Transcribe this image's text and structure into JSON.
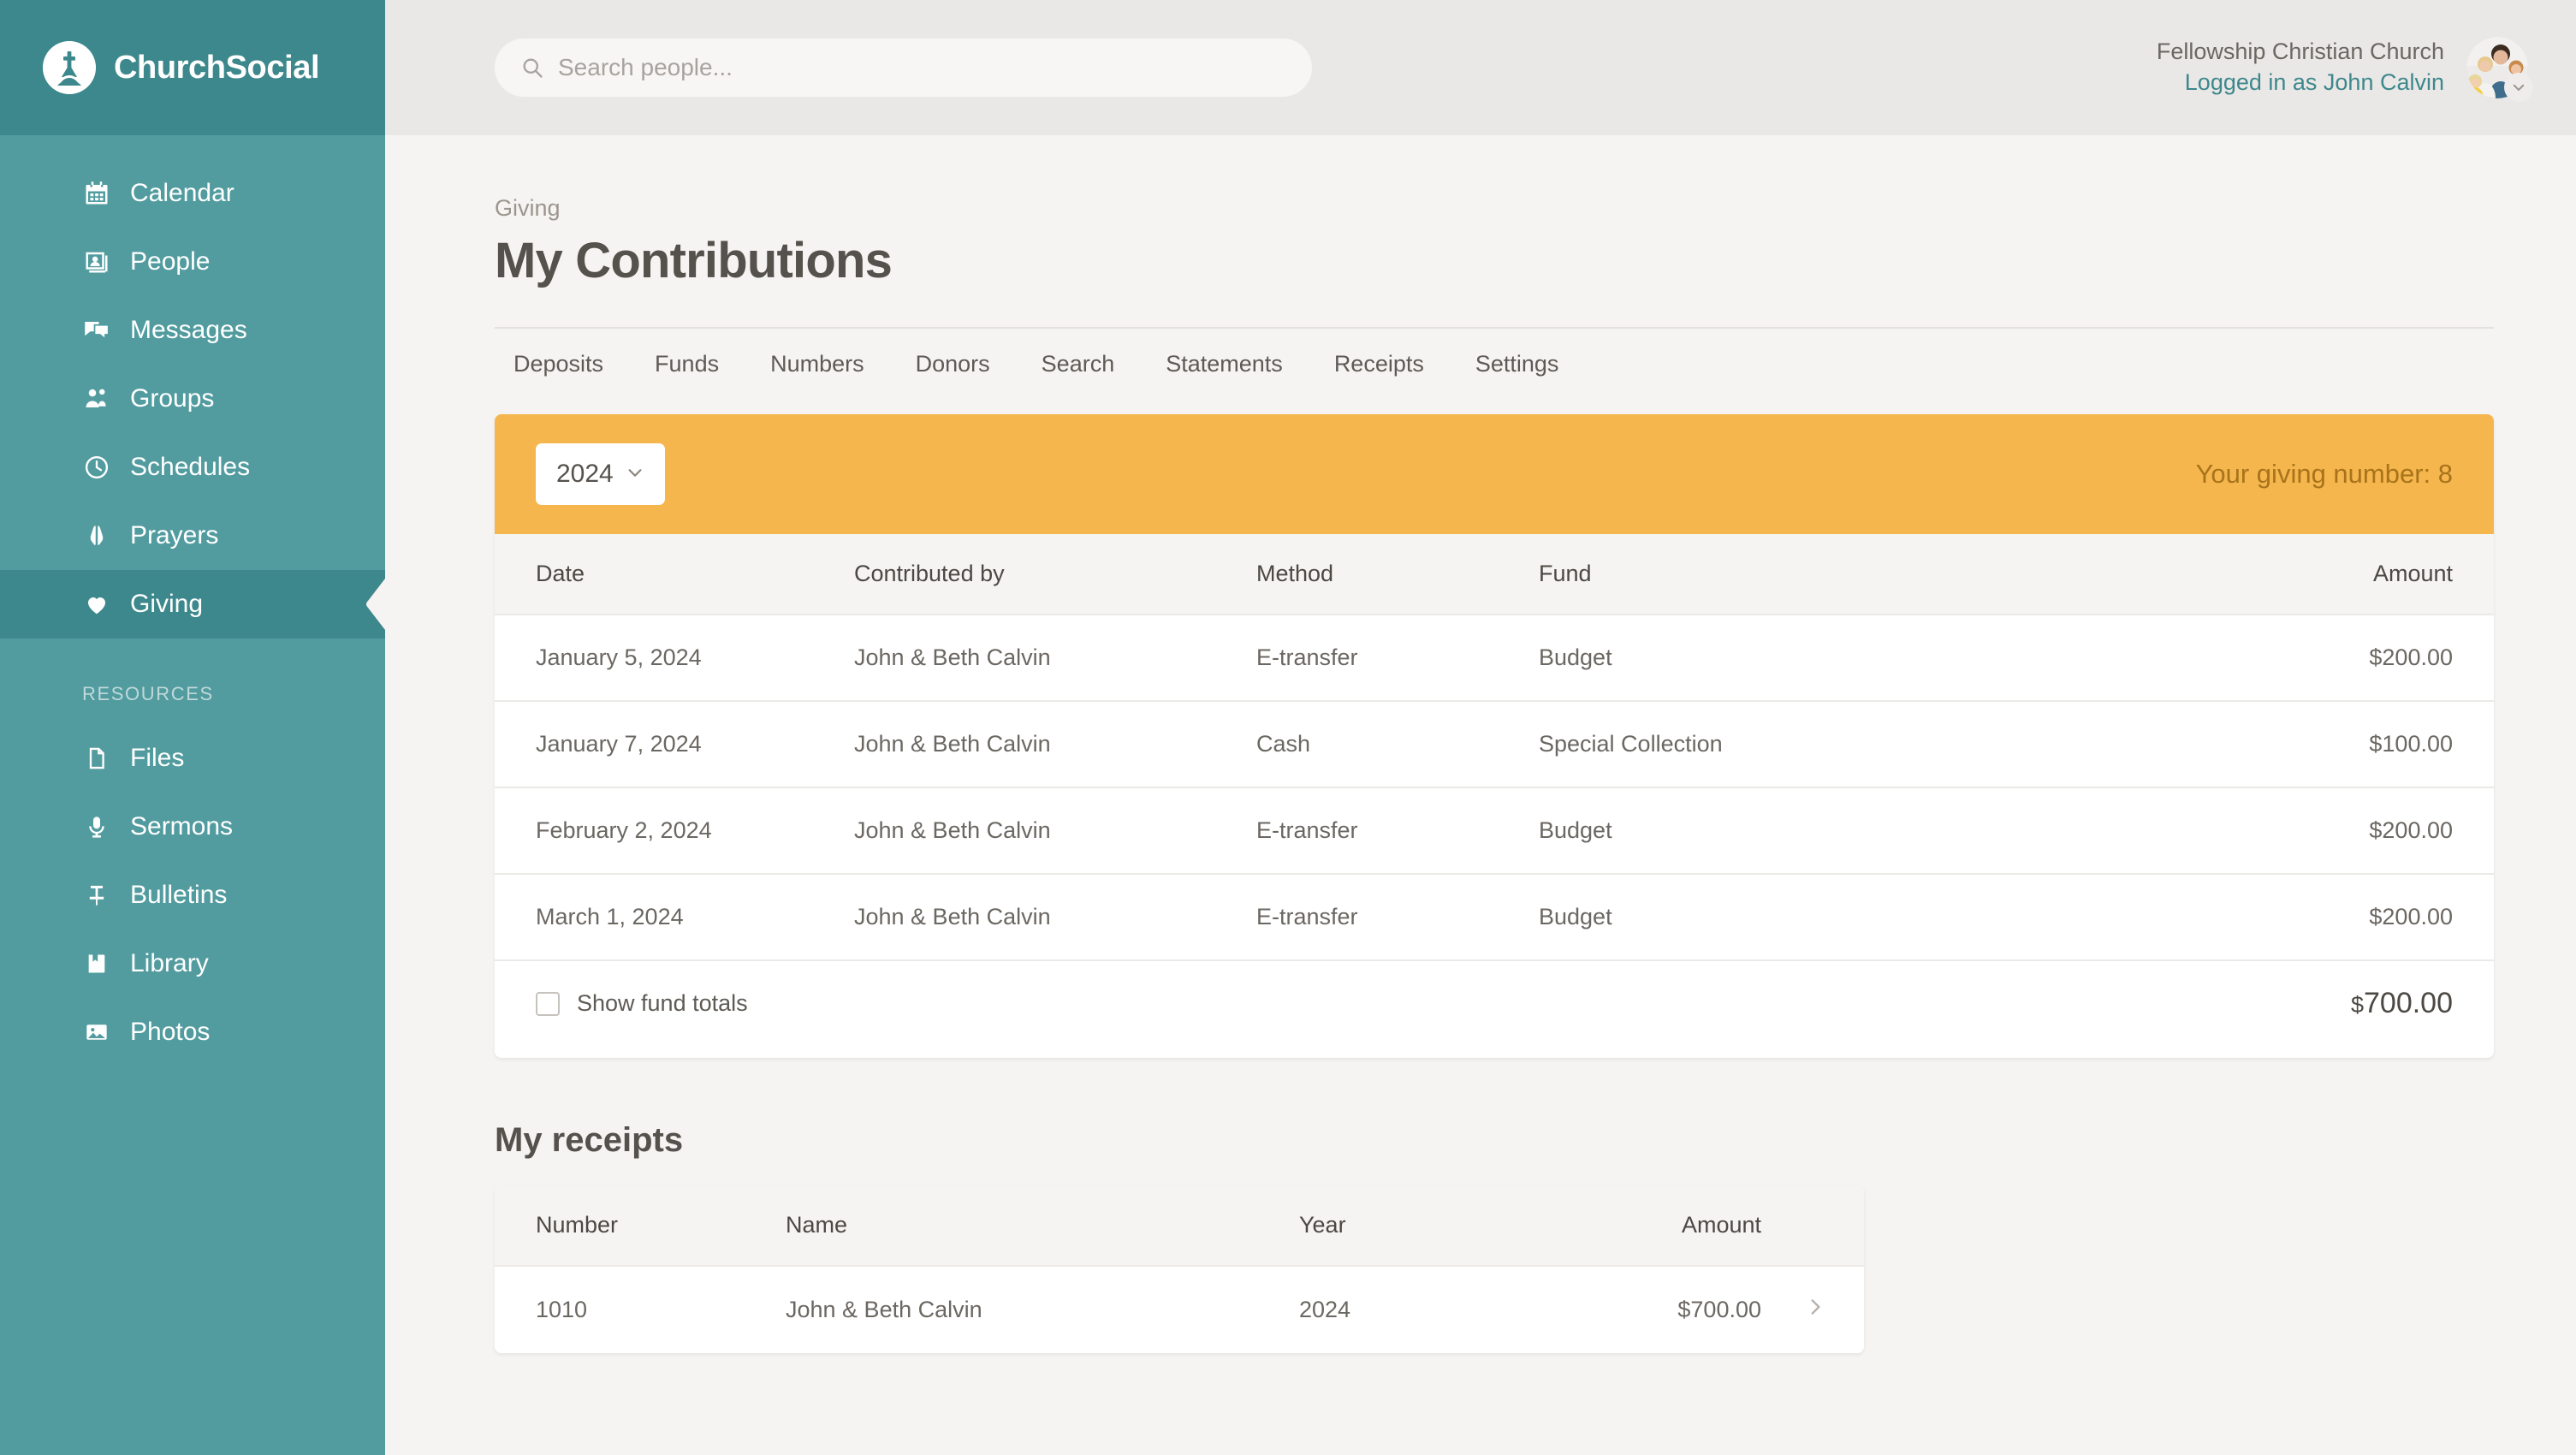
{
  "brand": {
    "name": "ChurchSocial",
    "logo_icon": "church-cross-icon",
    "sidebar_color": "#529CA0",
    "sidebar_active_color": "#3D888C",
    "accent_color": "#3D888C",
    "banner_color": "#F5B64D"
  },
  "search": {
    "placeholder": "Search people...",
    "value": "",
    "icon": "search-icon"
  },
  "user": {
    "church": "Fellowship Christian Church",
    "logged_in_as": "Logged in as John Calvin",
    "avatar_icon": "family-photo-avatar",
    "caret_icon": "chevron-down-icon"
  },
  "sidebar": {
    "items": [
      {
        "label": "Calendar",
        "icon": "calendar-icon",
        "active": false
      },
      {
        "label": "People",
        "icon": "people-icon",
        "active": false
      },
      {
        "label": "Messages",
        "icon": "messages-icon",
        "active": false
      },
      {
        "label": "Groups",
        "icon": "groups-icon",
        "active": false
      },
      {
        "label": "Schedules",
        "icon": "clock-icon",
        "active": false
      },
      {
        "label": "Prayers",
        "icon": "praying-hands-icon",
        "active": false
      },
      {
        "label": "Giving",
        "icon": "heart-icon",
        "active": true
      }
    ],
    "resources_title": "RESOURCES",
    "resources": [
      {
        "label": "Files",
        "icon": "file-icon"
      },
      {
        "label": "Sermons",
        "icon": "microphone-icon"
      },
      {
        "label": "Bulletins",
        "icon": "pin-icon"
      },
      {
        "label": "Library",
        "icon": "book-icon"
      },
      {
        "label": "Photos",
        "icon": "photo-icon"
      }
    ]
  },
  "page": {
    "breadcrumb": "Giving",
    "title": "My Contributions"
  },
  "tabs": [
    {
      "label": "Deposits"
    },
    {
      "label": "Funds"
    },
    {
      "label": "Numbers"
    },
    {
      "label": "Donors"
    },
    {
      "label": "Search"
    },
    {
      "label": "Statements"
    },
    {
      "label": "Receipts"
    },
    {
      "label": "Settings"
    }
  ],
  "contributions": {
    "year_selected": "2024",
    "year_caret_icon": "chevron-down-icon",
    "giving_number_label": "Your giving number: 8",
    "columns": [
      "Date",
      "Contributed by",
      "Method",
      "Fund",
      "Amount"
    ],
    "rows": [
      {
        "date": "January 5, 2024",
        "contributed_by": "John & Beth Calvin",
        "method": "E-transfer",
        "fund": "Budget",
        "amount": "$200.00"
      },
      {
        "date": "January 7, 2024",
        "contributed_by": "John & Beth Calvin",
        "method": "Cash",
        "fund": "Special Collection",
        "amount": "$100.00"
      },
      {
        "date": "February 2, 2024",
        "contributed_by": "John & Beth Calvin",
        "method": "E-transfer",
        "fund": "Budget",
        "amount": "$200.00"
      },
      {
        "date": "March 1, 2024",
        "contributed_by": "John & Beth Calvin",
        "method": "E-transfer",
        "fund": "Budget",
        "amount": "$200.00"
      }
    ],
    "show_fund_totals_label": "Show fund totals",
    "show_fund_totals_checked": false,
    "total_currency": "$",
    "total_amount": "700.00"
  },
  "receipts": {
    "title": "My receipts",
    "columns": [
      "Number",
      "Name",
      "Year",
      "Amount"
    ],
    "rows": [
      {
        "number": "1010",
        "name": "John & Beth Calvin",
        "year": "2024",
        "amount": "$700.00",
        "chevron_icon": "chevron-right-icon"
      }
    ]
  }
}
